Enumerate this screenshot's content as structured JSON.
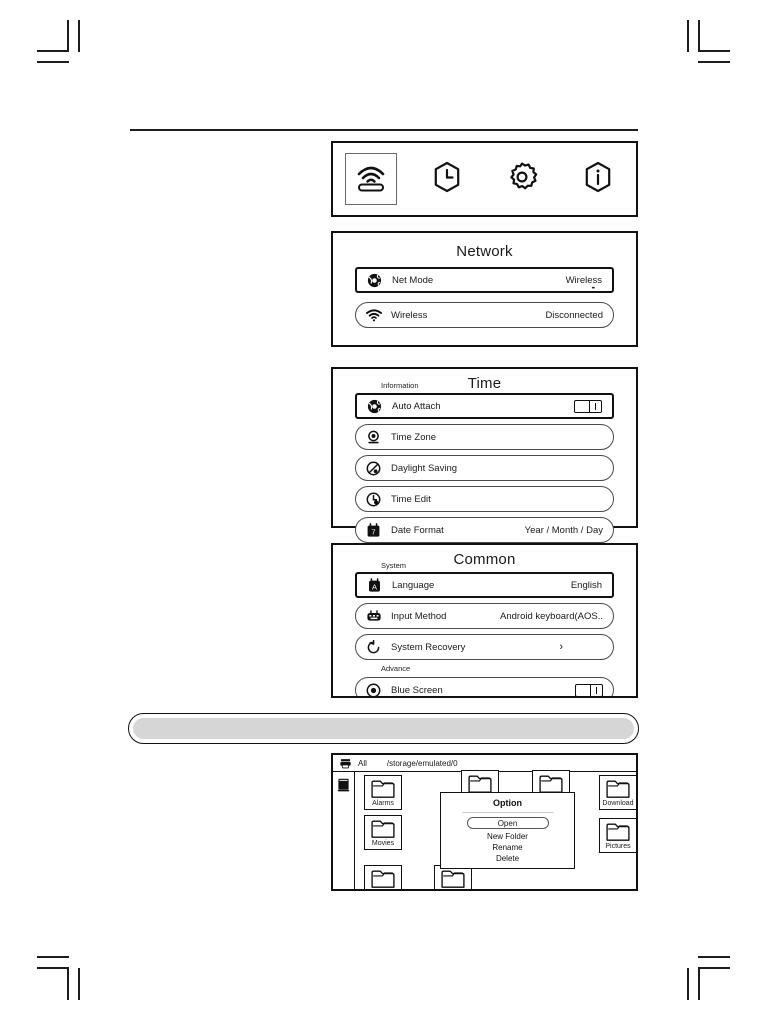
{
  "icon_bar": {
    "items": [
      {
        "name": "router-icon",
        "label": "Network",
        "selected": true
      },
      {
        "name": "clock-icon",
        "label": "Time",
        "selected": false
      },
      {
        "name": "gear-icon",
        "label": "Common",
        "selected": false
      },
      {
        "name": "info-icon",
        "label": "Information",
        "selected": false
      }
    ]
  },
  "network": {
    "title": "Network",
    "rows": [
      {
        "icon": "globe-network-icon",
        "label": "Net Mode",
        "value": "Wireless",
        "sub_arrow": "••",
        "focused": true
      },
      {
        "icon": "wifi-icon",
        "label": "Wireless",
        "value": "Disconnected",
        "focused": false
      }
    ]
  },
  "time": {
    "title": "Time",
    "group_label": "Information",
    "rows": [
      {
        "icon": "globe-network-icon",
        "label": "Auto Attach",
        "control": "toggle",
        "toggle_on": true,
        "focused": true
      },
      {
        "icon": "location-pin-icon",
        "label": "Time Zone",
        "control": "none",
        "focused": false
      },
      {
        "icon": "daylight-saving-icon",
        "label": "Daylight Saving",
        "control": "none",
        "focused": false
      },
      {
        "icon": "clock-edit-icon",
        "label": "Time Edit",
        "control": "none",
        "focused": false
      },
      {
        "icon": "calendar-icon",
        "label": "Date Format",
        "control": "value",
        "value": "Year / Month / Day",
        "focused": false
      }
    ]
  },
  "common": {
    "title": "Common",
    "group_labels": {
      "system": "System",
      "advance": "Advance"
    },
    "rows": [
      {
        "icon": "language-icon",
        "label": "Language",
        "control": "value",
        "value": "English",
        "focused": true
      },
      {
        "icon": "keyboard-icon",
        "label": "Input Method",
        "control": "value",
        "value": "Android keyboard(AOS..",
        "focused": false
      },
      {
        "icon": "restore-icon",
        "label": "System Recovery",
        "control": "chevron",
        "value": "›",
        "focused": false
      },
      {
        "icon": "blue-screen-icon",
        "label": "Blue Screen",
        "control": "toggle",
        "toggle_on": true,
        "focused": false
      },
      {
        "icon": "user-icon",
        "label": "",
        "control": "none",
        "focused": false
      }
    ]
  },
  "file_browser": {
    "header": {
      "storage_icon": "storage-device-icon",
      "all_label": "All",
      "path": "/storage/emulated/0"
    },
    "sidebar_icon": "internal-storage-icon",
    "folders": [
      {
        "name": "Alarms",
        "has_label": true
      },
      {
        "name": "Movies",
        "has_label": true
      },
      {
        "name": "",
        "has_label": false
      },
      {
        "name": "",
        "has_label": false
      },
      {
        "name": "",
        "has_label": false
      },
      {
        "name": "",
        "has_label": false
      },
      {
        "name": "Download",
        "has_label": true
      },
      {
        "name": "Pictures",
        "has_label": true
      }
    ],
    "option_dialog": {
      "title": "Option",
      "primary_action": "Open",
      "items": [
        "New Folder",
        "Rename",
        "Delete"
      ]
    }
  },
  "colors": {
    "ink": "#1a1a1a",
    "border": "#111111",
    "muted_border": "#4a4a4a",
    "gray_fill": "#d6d6d6"
  }
}
